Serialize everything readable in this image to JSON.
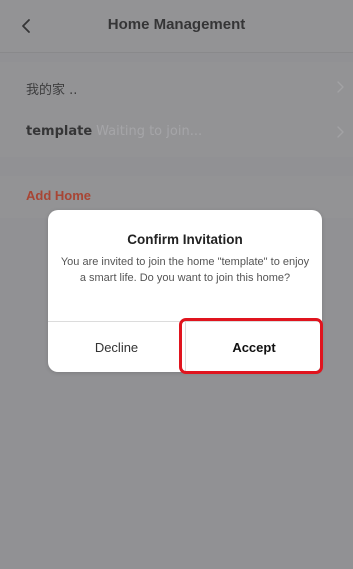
{
  "header": {
    "title": "Home Management",
    "back_icon": "chevron-left-icon"
  },
  "homes": [
    {
      "name": "我的家 ..",
      "status": ""
    },
    {
      "name": "template",
      "status": "Waiting to join..."
    }
  ],
  "add_home_label": "Add Home",
  "colors": {
    "accent": "#b8341c",
    "highlight": "#e0141e"
  },
  "dialog": {
    "title": "Confirm Invitation",
    "message": "You are invited to join the home \"template\" to enjoy a smart life. Do you want to join this home?",
    "decline_label": "Decline",
    "accept_label": "Accept"
  }
}
